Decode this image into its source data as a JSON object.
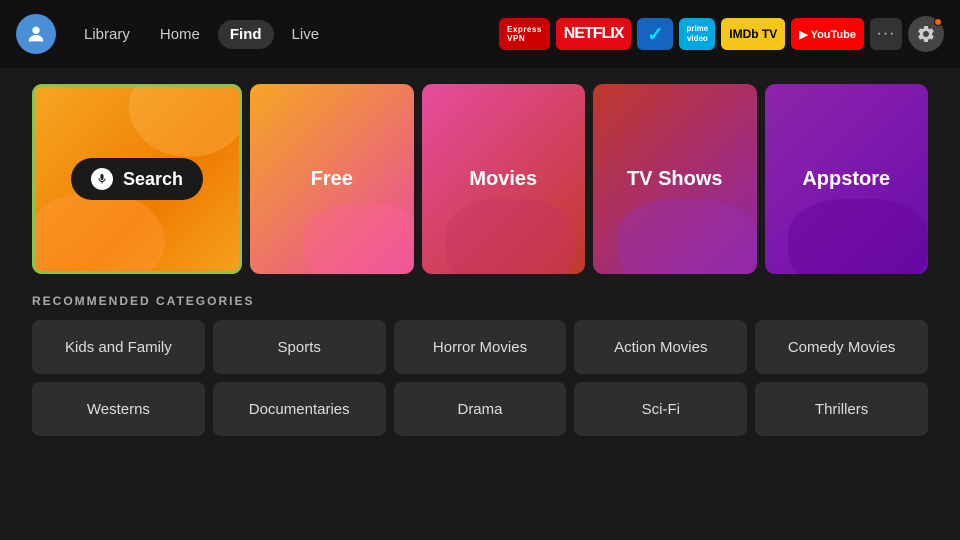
{
  "nav": {
    "avatar_icon": "👤",
    "links": [
      {
        "label": "Library",
        "active": false
      },
      {
        "label": "Home",
        "active": false
      },
      {
        "label": "Find",
        "active": true
      },
      {
        "label": "Live",
        "active": false
      }
    ],
    "apps": [
      {
        "id": "expressvpn",
        "label": "ExpressVPN",
        "class": "app-expressvpn"
      },
      {
        "id": "netflix",
        "label": "NETFLIX",
        "class": "app-netflix"
      },
      {
        "id": "freevee",
        "label": "≥",
        "class": "app-freevee"
      },
      {
        "id": "prime",
        "label": "prime\nvideo",
        "class": "app-prime"
      },
      {
        "id": "imdb",
        "label": "IMDb TV",
        "class": "app-imdb"
      },
      {
        "id": "youtube",
        "label": "▶ YouTube",
        "class": "app-youtube"
      }
    ],
    "more_label": "···",
    "settings_icon": "⚙"
  },
  "tiles": [
    {
      "id": "search",
      "label": "Search",
      "type": "search"
    },
    {
      "id": "free",
      "label": "Free",
      "type": "free"
    },
    {
      "id": "movies",
      "label": "Movies",
      "type": "movies"
    },
    {
      "id": "tvshows",
      "label": "TV Shows",
      "type": "tvshows"
    },
    {
      "id": "appstore",
      "label": "Appstore",
      "type": "appstore"
    }
  ],
  "recommended": {
    "title": "RECOMMENDED CATEGORIES",
    "rows": [
      [
        {
          "label": "Kids and Family"
        },
        {
          "label": "Sports"
        },
        {
          "label": "Horror Movies"
        },
        {
          "label": "Action Movies"
        },
        {
          "label": "Comedy Movies"
        }
      ],
      [
        {
          "label": "Westerns"
        },
        {
          "label": "Documentaries"
        },
        {
          "label": "Drama"
        },
        {
          "label": "Sci-Fi"
        },
        {
          "label": "Thrillers"
        }
      ]
    ]
  }
}
